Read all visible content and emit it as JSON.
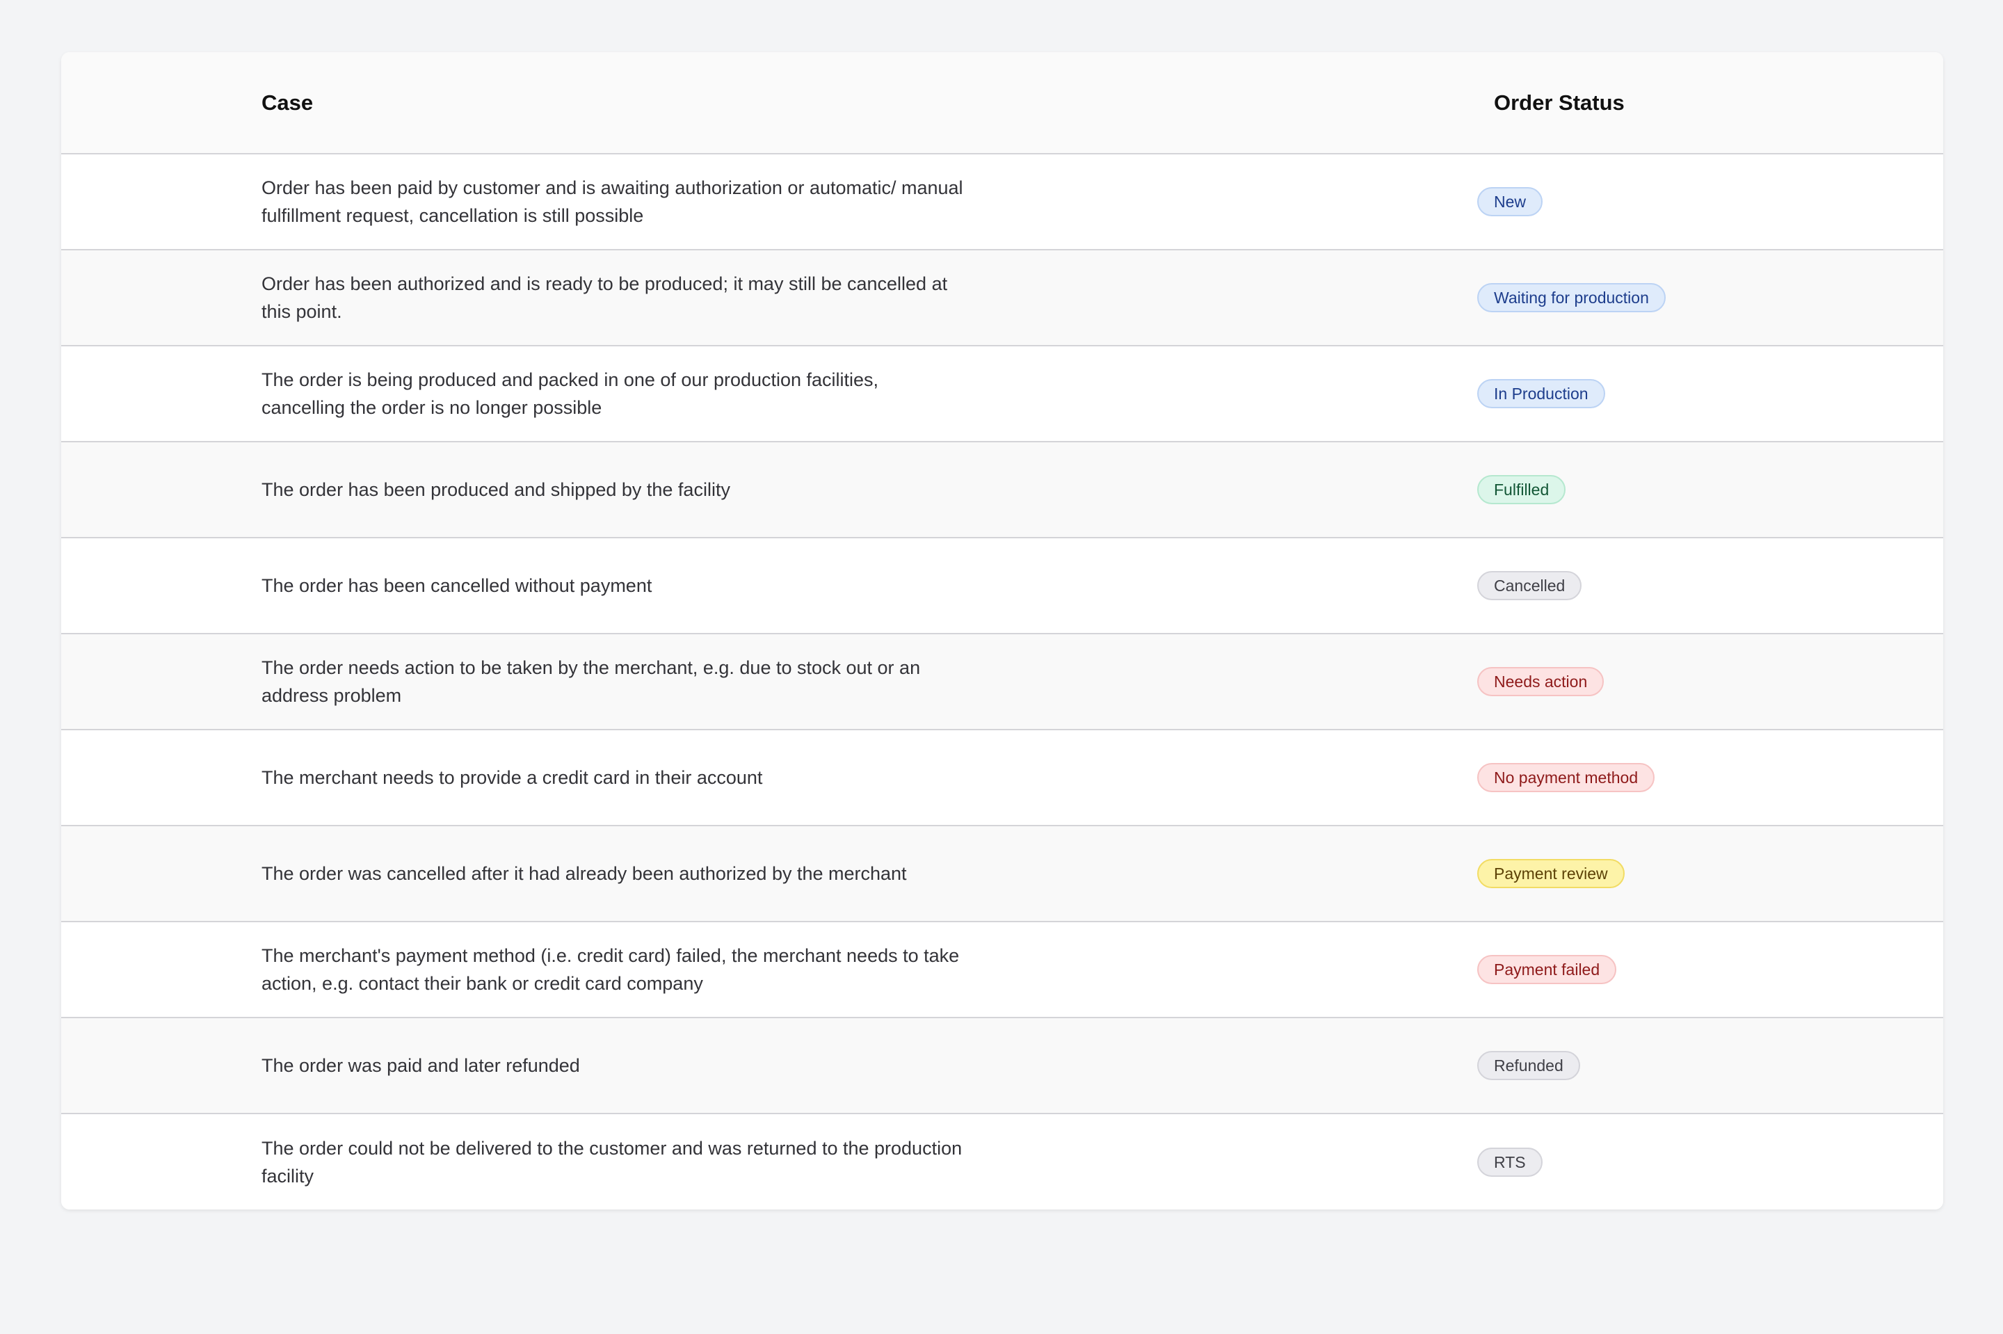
{
  "table": {
    "headers": {
      "case": "Case",
      "status": "Order Status"
    },
    "rows": [
      {
        "case": "Order has been paid by customer and is awaiting authorization or automatic/ manual fulfillment request, cancellation is still possible",
        "status": "New",
        "status_color": "blue"
      },
      {
        "case": "Order has been authorized and is ready to be produced; it may still be cancelled at this point.",
        "status": "Waiting for production",
        "status_color": "blue"
      },
      {
        "case": "The order is being produced and packed in one of our production facilities, cancelling the order is no longer possible",
        "status": "In Production",
        "status_color": "blue"
      },
      {
        "case": "The order has been produced and shipped by the facility",
        "status": "Fulfilled",
        "status_color": "green"
      },
      {
        "case": "The order has been cancelled without payment",
        "status": "Cancelled",
        "status_color": "gray"
      },
      {
        "case": "The order needs action to be taken by the merchant, e.g. due to stock out or an address problem",
        "status": "Needs action",
        "status_color": "red"
      },
      {
        "case": "The merchant needs to provide a credit card in their account",
        "status": "No payment method",
        "status_color": "red"
      },
      {
        "case": "The order was cancelled after it had already been authorized by the merchant",
        "status": "Payment review",
        "status_color": "yellow"
      },
      {
        "case": "The merchant's payment method (i.e. credit card) failed, the merchant needs to take action, e.g. contact their bank or credit card company",
        "status": "Payment failed",
        "status_color": "red"
      },
      {
        "case": "The order was paid and later refunded",
        "status": "Refunded",
        "status_color": "gray"
      },
      {
        "case": "The order could not be delivered to the customer and was returned to the production facility",
        "status": "RTS",
        "status_color": "gray"
      }
    ]
  },
  "colors": {
    "page_background": "#f3f4f6",
    "blue_badge": "#dfebfb",
    "green_badge": "#dcf6ea",
    "gray_badge": "#ececf0",
    "red_badge": "#fde3e3",
    "yellow_badge": "#fdf3a8"
  }
}
